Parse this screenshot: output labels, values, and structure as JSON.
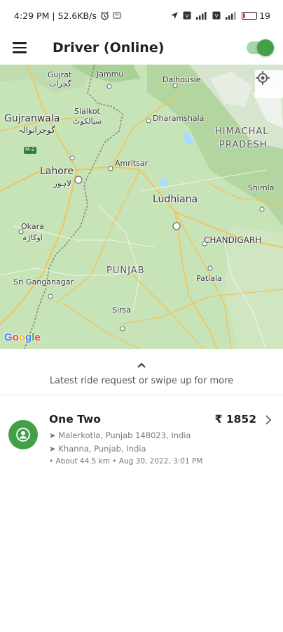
{
  "status_bar": {
    "time_speed": "4:29 PM | 52.6KB/s",
    "battery": "19",
    "battery_level": 0.19
  },
  "app_bar": {
    "title": "Driver (Online)",
    "online": true
  },
  "map": {
    "labels": {
      "gujrat": "Gujrat",
      "gujrat_ur": "گجرات",
      "jammu": "Jammu",
      "dalhousie": "Dalhousie",
      "gujranwala": "Gujranwala",
      "gujranwala_ur": "گوجرانوالہ",
      "sialkot": "Sialkot",
      "sialkot_ur": "سیالکوٹ",
      "dharamshala": "Dharamshala",
      "himachal": "HIMACHAL",
      "pradesh": "PRADESH",
      "m2": "M-2",
      "amritsar": "Amritsar",
      "lahore": "Lahore",
      "lahore_ur": "لاہور",
      "shimla": "Shimla",
      "ludhiana": "Ludhiana",
      "okara": "Okara",
      "okara_ur": "اوکاڑہ",
      "chandigarh": "CHANDIGARH",
      "punjab": "PUNJAB",
      "patiala": "Patiala",
      "sri_ganganagar": "Sri Ganganagar",
      "sirsa": "Sirsa"
    },
    "attribution": [
      "G",
      "o",
      "o",
      "g",
      "l",
      "e"
    ],
    "attribution_colors": [
      "#4285F4",
      "#EA4335",
      "#FBBC05",
      "#4285F4",
      "#34A853",
      "#EA4335"
    ]
  },
  "sheet": {
    "hint": "Latest ride request or swipe up for more"
  },
  "ride": {
    "name": "One Two",
    "fare": "₹ 1852",
    "pickup": "➤ Malerkotla, Punjab 148023, India",
    "dropoff": "➤ Khanna, Punjab, India",
    "meta": "• About 44.5 km • Aug 30, 2022, 3:01 PM"
  },
  "colors": {
    "accent": "#43a047",
    "map_bg": "#c7e3b8"
  }
}
